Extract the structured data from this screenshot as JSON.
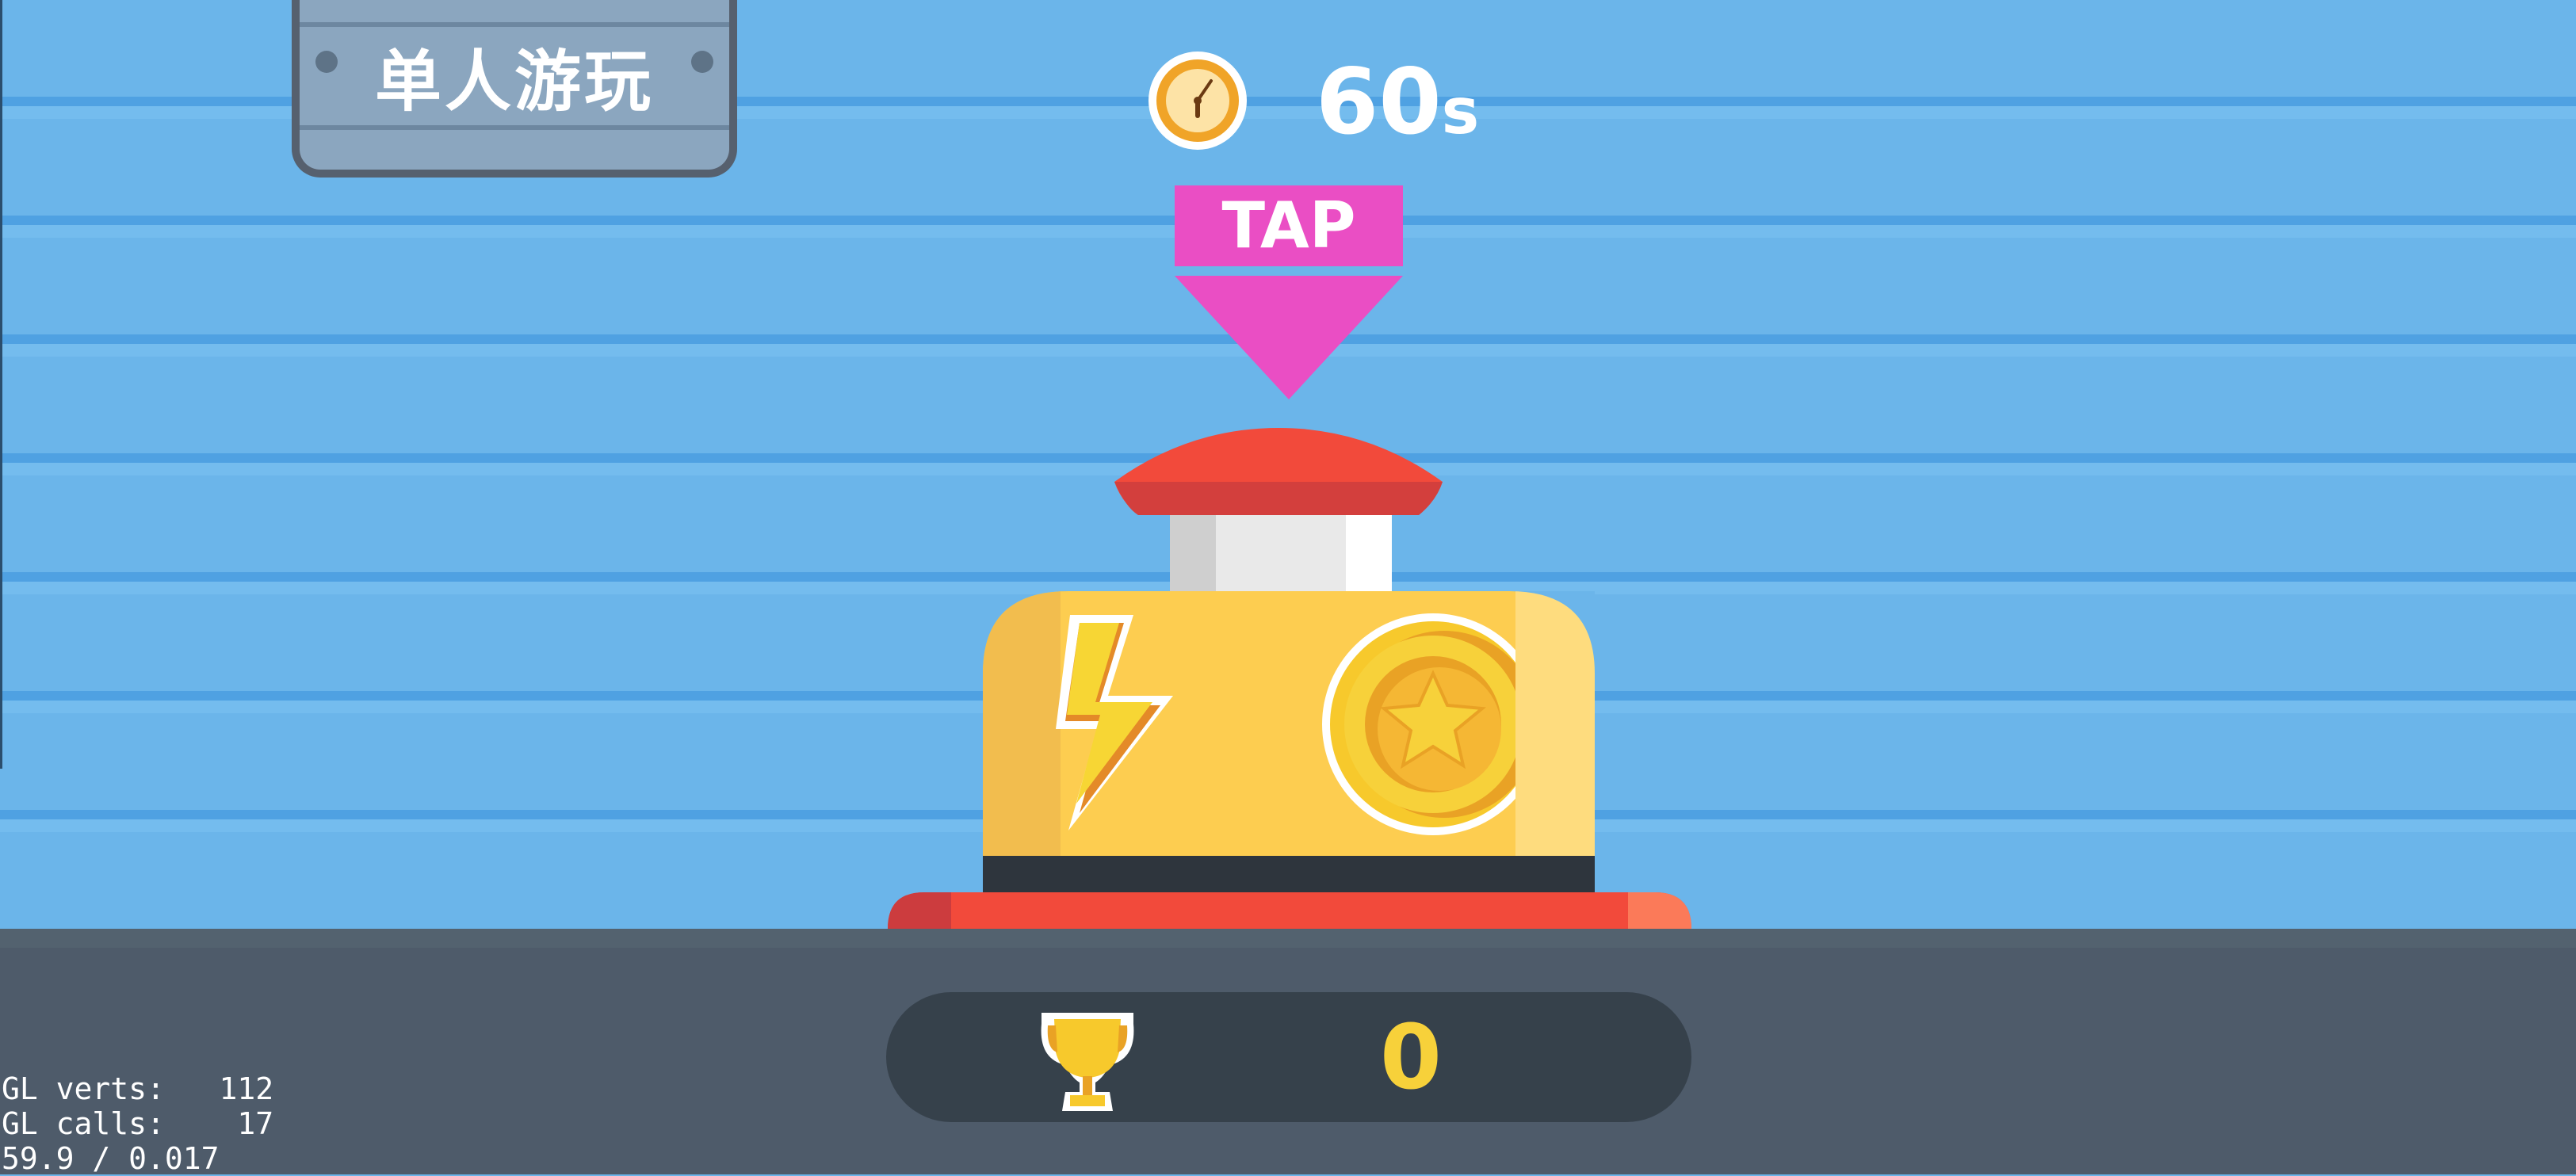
{
  "mode_button": {
    "label": "单人游玩"
  },
  "timer": {
    "value": "60",
    "unit": "s",
    "icon": "clock-icon"
  },
  "tap_prompt": {
    "label": "TAP",
    "icon": "arrow-down-icon"
  },
  "buzzer": {
    "icons": [
      "lightning-icon",
      "star-coin-icon"
    ]
  },
  "score": {
    "value": "0",
    "icon": "trophy-icon"
  },
  "debug": {
    "line1": "GL verts:   112",
    "line2": "GL calls:    17",
    "line3": "59.9 / 0.017"
  },
  "colors": {
    "sky": "#6bb5ea",
    "floor": "#4e5b6a",
    "tap": "#ea4ec4",
    "button_red": "#f24a3b",
    "body_yellow": "#fdcd50",
    "score_yellow": "#f7d13a"
  }
}
